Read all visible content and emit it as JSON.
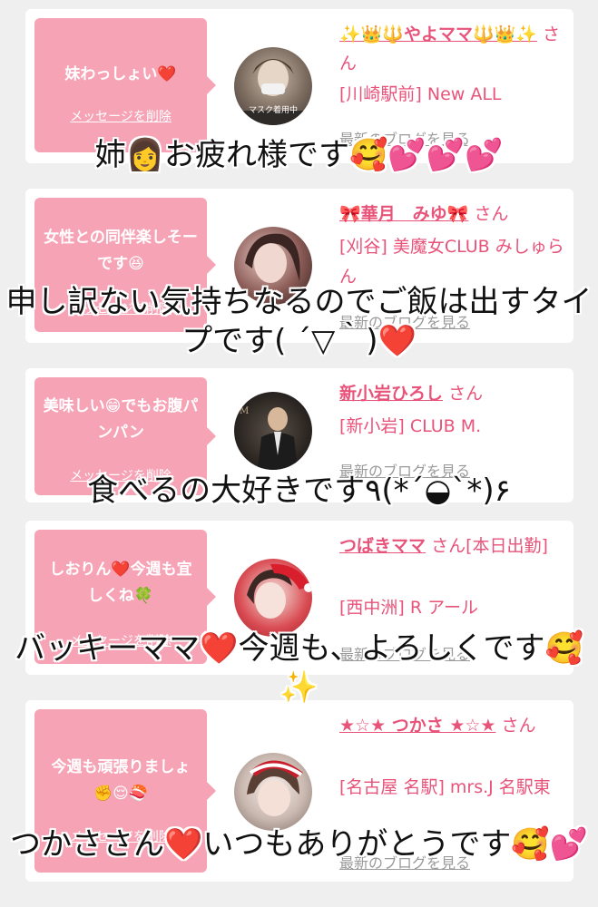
{
  "cards": [
    {
      "message": "妹わっしょい❤️",
      "delete_label": "メッセージを削除",
      "name": "✨👑🔱やよママ🔱👑✨",
      "san": "さん",
      "shop": "[川崎駅前] New ALL",
      "blog_label": "最新のブログを見る",
      "avatar_caption": "マスク着用中",
      "overlay": "姉👩お疲れ様です🥰💕💕💕"
    },
    {
      "message": "女性との同伴楽しそーです😆",
      "delete_label": "メッセージを削除",
      "name": "🎀華月　みゆ🎀",
      "san": "さん",
      "shop": "[刈谷] 美魔女CLUB みしゅらん",
      "blog_label": "最新のブログを見る",
      "overlay": "申し訳ない気持ちなるのでご飯は出すタイプです( ´▽｀)❤️"
    },
    {
      "message": "美味しい😁でもお腹パンパン",
      "delete_label": "メッセージを削除",
      "name": "新小岩ひろし",
      "san": "さん",
      "shop": "[新小岩] CLUB M.",
      "blog_label": "最新のブログを見る",
      "overlay": "食べるの大好きです٩(*´◒`*)۶"
    },
    {
      "message": "しおりん❤️今週も宜しくね🍀",
      "delete_label": "メッセージを削除",
      "name": "つばきママ",
      "san": "さん[本日出勤]",
      "shop": "[西中洲] R アール",
      "blog_label": "最新のブログを見る",
      "overlay": "バッキーママ❤️今週も、よろしくです🥰✨"
    },
    {
      "message": "今週も頑張りましょ✊😌🍣",
      "delete_label": "メッセージを削除",
      "name": "★☆★ つかさ ★☆★",
      "san": "さん",
      "shop": "[名古屋 名駅] mrs.J 名駅東",
      "blog_label": "最新のブログを見る",
      "overlay": "つかささん❤️いつもありがとうです🥰💕"
    }
  ],
  "colors": {
    "background": "#efefef",
    "bubble": "#f7a3b6",
    "accent": "#e8537a",
    "muted": "#9a9a9a"
  }
}
